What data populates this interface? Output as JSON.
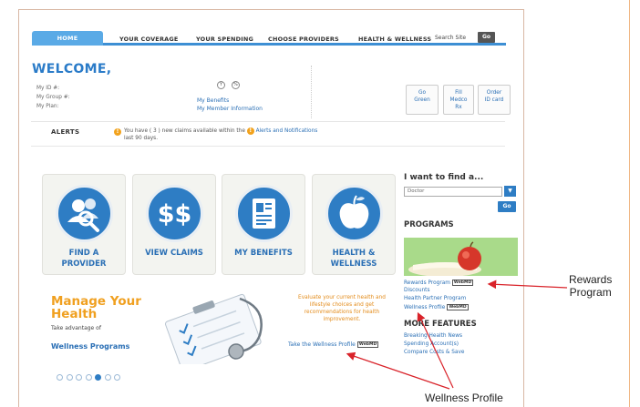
{
  "nav": {
    "tabs": [
      "HOME",
      "YOUR COVERAGE",
      "YOUR SPENDING",
      "CHOOSE PROVIDERS",
      "HEALTH & WELLNESS"
    ],
    "search_label": "Search Site",
    "go_label": "Go"
  },
  "welcome": {
    "title": "WELCOME,",
    "id_lines": [
      "My ID #:",
      "My Group #:",
      "My Plan:"
    ],
    "icons": [
      "Y",
      "%"
    ],
    "links": [
      "My Benefits",
      "My Member Information"
    ],
    "quick_buttons": [
      {
        "line1": "Go",
        "line2": "Green"
      },
      {
        "line1": "Fill",
        "line2": "Medco",
        "line3": "Rx"
      },
      {
        "line1": "Order",
        "line2": "ID card"
      }
    ]
  },
  "alerts": {
    "label": "ALERTS",
    "text_before": "You have ( 3 ) new claims available within the",
    "link": "Alerts and Notifications",
    "text_after": "last 90 days."
  },
  "tiles": [
    {
      "label_line1": "FIND A",
      "label_line2": "PROVIDER",
      "icon": "people-search-icon"
    },
    {
      "label_line1": "VIEW CLAIMS",
      "label_line2": "",
      "icon": "dollar-icon"
    },
    {
      "label_line1": "MY BENEFITS",
      "label_line2": "",
      "icon": "id-card-icon"
    },
    {
      "label_line1": "HEALTH &",
      "label_line2": "WELLNESS",
      "icon": "apple-icon"
    }
  ],
  "find": {
    "title": "I want to find a...",
    "selected": "Doctor",
    "go_label": "Go"
  },
  "programs": {
    "title": "PROGRAMS",
    "links": [
      "Rewards Program",
      "Discounts",
      "Health Partner Program",
      "Wellness Profile"
    ],
    "badge": "WebMD"
  },
  "more_features": {
    "title": "MORE FEATURES",
    "links": [
      "Breaking Health News",
      "Spending Account(s)",
      "Compare Costs & Save"
    ]
  },
  "banner": {
    "title_line1": "Manage Your",
    "title_line2": "Health",
    "take_advantage": "Take advantage of",
    "programs_link": "Wellness Programs",
    "evaluate_text": "Evaluate your current health and lifestyle choices and get recommendations for health improvement.",
    "take_profile": "Take the Wellness Profile",
    "dot_count": 7,
    "active_dot": 4
  },
  "annotations": {
    "rewards_line1": "Rewards",
    "rewards_line2": "Program",
    "wellness": "Wellness Profile"
  },
  "colors": {
    "brand_blue": "#2e7dc4",
    "accent_orange": "#f0a020",
    "arrow_red": "#d9232a"
  }
}
